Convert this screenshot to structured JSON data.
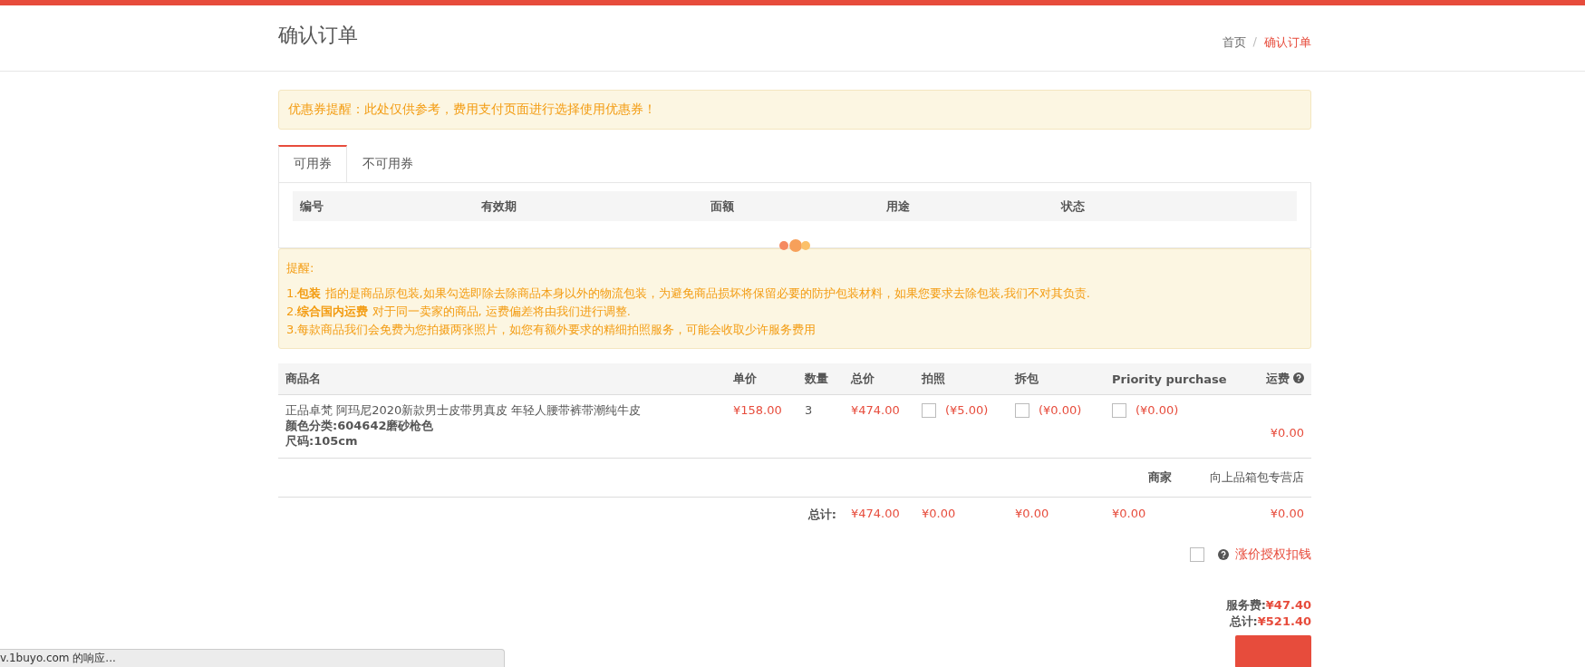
{
  "header": {
    "title": "确认订单",
    "separator": "/",
    "breadcrumb": [
      {
        "label": "首页",
        "selected": false
      },
      {
        "label": "确认订单",
        "selected": true
      }
    ]
  },
  "coupon_alert": "优惠券提醒：此处仅供参考，费用支付页面进行选择使用优惠券！",
  "coupon_tabs": [
    {
      "label": "可用券",
      "selected": true
    },
    {
      "label": "不可用券",
      "selected": false
    }
  ],
  "coupon_table": {
    "columns": [
      "编号",
      "有效期",
      "面额",
      "用途",
      "状态"
    ]
  },
  "notice": {
    "title": "提醒:",
    "lines": [
      "1.**包装** 指的是商品原包装,如果勾选即除去除商品本身以外的物流包装，为避免商品损坏将保留必要的防护包装材料，如果您要求去除包装,我们不对其负责.",
      "2.**综合国内运费** 对于同一卖家的商品, 运费偏差将由我们进行调整.",
      "3.每款商品我们会免费为您拍摄两张照片，如您有额外要求的精细拍照服务，可能会收取少许服务费用"
    ]
  },
  "order_table": {
    "columns": [
      {
        "label": "商品名",
        "help": false
      },
      {
        "label": "单价",
        "help": false
      },
      {
        "label": "数量",
        "help": false
      },
      {
        "label": "总价",
        "help": false
      },
      {
        "label": "拍照",
        "help": false
      },
      {
        "label": "拆包",
        "help": false
      },
      {
        "label": "Priority purchase",
        "help": false
      },
      {
        "label": "运费",
        "help": true
      }
    ],
    "rows": [
      {
        "name": "正品卓梵 阿玛尼2020新款男士皮带男真皮 年轻人腰带裤带潮纯牛皮",
        "attributes": [
          "颜色分类:604642磨砂枪色",
          "尺码:105cm"
        ],
        "unit_price": "¥158.00",
        "quantity": "3",
        "total": "¥474.00",
        "options": [
          {
            "price": "(¥5.00)",
            "checked": false
          },
          {
            "price": "(¥0.00)",
            "checked": false
          },
          {
            "price": "(¥0.00)",
            "checked": false
          }
        ],
        "shipping": "¥0.00"
      }
    ],
    "merchant": {
      "label": "商家",
      "value": "向上品箱包专营店"
    },
    "totals": {
      "label": "总计:",
      "total": "¥474.00",
      "photo": "¥0.00",
      "unbox": "¥0.00",
      "priority": "¥0.00",
      "shipping": "¥0.00"
    }
  },
  "price_increase": {
    "label": "涨价授权扣钱",
    "checked": false
  },
  "summary": [
    {
      "label": "服务费:",
      "value": "¥47.40"
    },
    {
      "label": "总计:",
      "value": "¥521.40"
    }
  ],
  "status_bar": "v.1buyo.com 的响应..."
}
